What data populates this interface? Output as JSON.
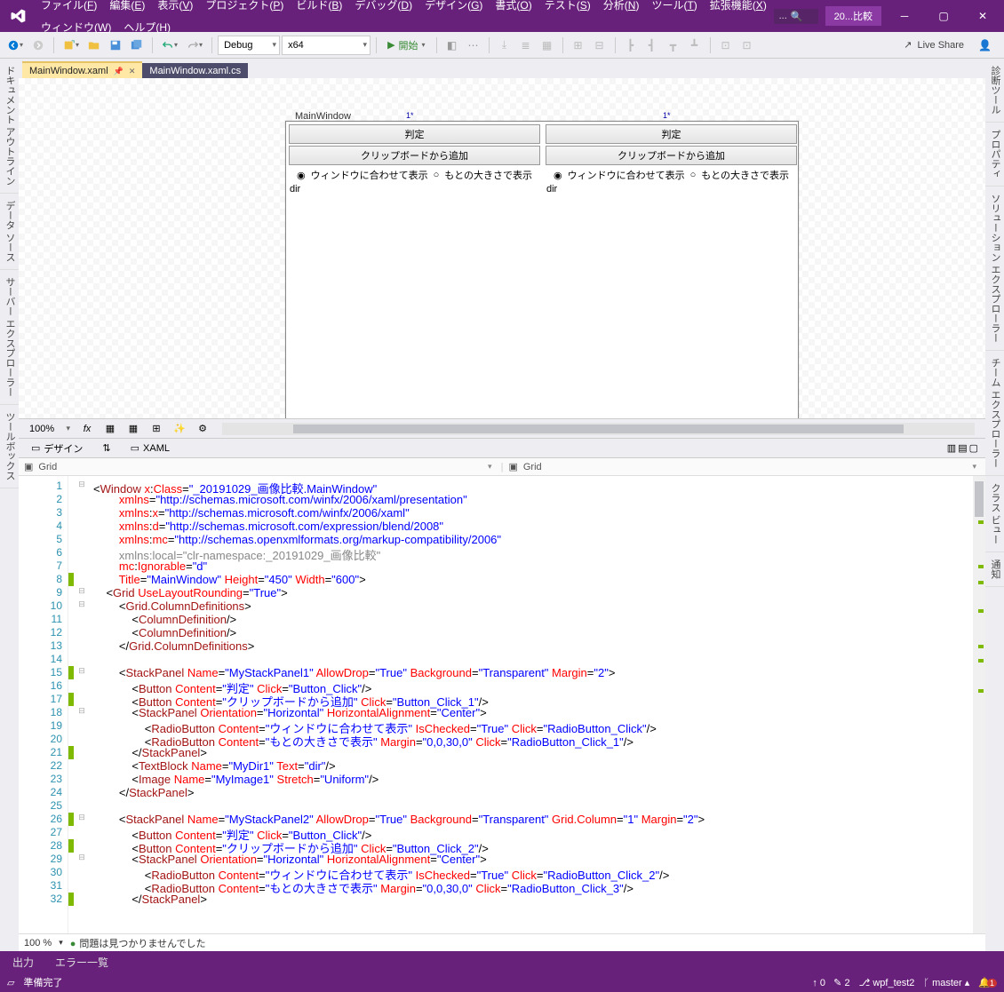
{
  "title_project": "20...比較",
  "search_placeholder": "...",
  "menus_row1": [
    "ファイル(F)",
    "編集(E)",
    "表示(V)",
    "プロジェクト(P)",
    "ビルド(B)",
    "デバッグ(D)",
    "デザイン(G)",
    "書式(O)",
    "テスト(S)",
    "分析(N)",
    "ツール(T)",
    "拡張機能(X)"
  ],
  "menus_row2": [
    "ウィンドウ(W)",
    "ヘルプ(H)"
  ],
  "toolbar": {
    "config": "Debug",
    "platform": "x64",
    "start": "開始",
    "liveshare": "Live Share"
  },
  "left_tabs": [
    "ドキュメント アウトライン",
    "データ ソース",
    "サーバー エクスプローラー",
    "ツールボックス"
  ],
  "right_tabs": [
    "診断ツール",
    "プロパティ",
    "ソリューション エクスプローラー",
    "チーム エクスプローラー",
    "クラス ビュー",
    "通知"
  ],
  "doc_tabs": [
    {
      "label": "MainWindow.xaml",
      "active": true
    },
    {
      "label": "MainWindow.xaml.cs",
      "active": false
    }
  ],
  "designer": {
    "window_title": "MainWindow",
    "col_star": "1*",
    "btn_judge": "判定",
    "btn_clip": "クリップボードから追加",
    "radio_fit": "ウィンドウに合わせて表示",
    "radio_orig": "もとの大きさで表示",
    "dir": "dir",
    "zoom": "100%"
  },
  "split": {
    "design_label": "デザイン",
    "swap": "⇅",
    "xaml_label": "XAML",
    "path_left": "Grid",
    "path_right": "Grid"
  },
  "code_lines": [
    {
      "n": 1,
      "fold": "⊟",
      "mark": "",
      "html": "&lt;<span class='t-brown'>Window</span> <span class='t-attr'>x</span>:<span class='t-attr'>Class</span>=<span class='t-val'>\"_20191029_画像比較.MainWindow\"</span>"
    },
    {
      "n": 2,
      "fold": "",
      "mark": "",
      "html": "        <span class='t-attr'>xmlns</span>=<span class='t-val'>\"http://schemas.microsoft.com/winfx/2006/xaml/presentation\"</span>"
    },
    {
      "n": 3,
      "fold": "",
      "mark": "",
      "html": "        <span class='t-attr'>xmlns</span>:<span class='t-attr'>x</span>=<span class='t-val'>\"http://schemas.microsoft.com/winfx/2006/xaml\"</span>"
    },
    {
      "n": 4,
      "fold": "",
      "mark": "",
      "html": "        <span class='t-attr'>xmlns</span>:<span class='t-attr'>d</span>=<span class='t-val'>\"http://schemas.microsoft.com/expression/blend/2008\"</span>"
    },
    {
      "n": 5,
      "fold": "",
      "mark": "",
      "html": "        <span class='t-attr'>xmlns</span>:<span class='t-attr'>mc</span>=<span class='t-val'>\"http://schemas.openxmlformats.org/markup-compatibility/2006\"</span>"
    },
    {
      "n": 6,
      "fold": "",
      "mark": "",
      "html": "        <span class='t-gray'>xmlns:local=\"clr-namespace:_20191029_画像比較\"</span>"
    },
    {
      "n": 7,
      "fold": "",
      "mark": "",
      "html": "        <span class='t-attr'>mc</span>:<span class='t-attr'>Ignorable</span>=<span class='t-val'>\"d\"</span>"
    },
    {
      "n": 8,
      "fold": "",
      "mark": "g",
      "html": "        <span class='t-attr'>Title</span>=<span class='t-val'>\"MainWindow\"</span> <span class='t-attr'>Height</span>=<span class='t-val'>\"450\"</span> <span class='t-attr'>Width</span>=<span class='t-val'>\"600\"</span>&gt;"
    },
    {
      "n": 9,
      "fold": "⊟",
      "mark": "",
      "html": "    &lt;<span class='t-brown'>Grid</span> <span class='t-attr'>UseLayoutRounding</span>=<span class='t-val'>\"True\"</span>&gt;"
    },
    {
      "n": 10,
      "fold": "⊟",
      "mark": "",
      "html": "        &lt;<span class='t-brown'>Grid.ColumnDefinitions</span>&gt;"
    },
    {
      "n": 11,
      "fold": "",
      "mark": "",
      "html": "            &lt;<span class='t-brown'>ColumnDefinition</span>/&gt;"
    },
    {
      "n": 12,
      "fold": "",
      "mark": "",
      "html": "            &lt;<span class='t-brown'>ColumnDefinition</span>/&gt;"
    },
    {
      "n": 13,
      "fold": "",
      "mark": "",
      "html": "        &lt;/<span class='t-brown'>Grid.ColumnDefinitions</span>&gt;"
    },
    {
      "n": 14,
      "fold": "",
      "mark": "",
      "html": ""
    },
    {
      "n": 15,
      "fold": "⊟",
      "mark": "g",
      "html": "        &lt;<span class='t-brown'>StackPanel</span> <span class='t-attr'>Name</span>=<span class='t-val'>\"MyStackPanel1\"</span> <span class='t-attr'>AllowDrop</span>=<span class='t-val'>\"True\"</span> <span class='t-attr'>Background</span>=<span class='t-val'>\"Transparent\"</span> <span class='t-attr'>Margin</span>=<span class='t-val'>\"2\"</span>&gt;"
    },
    {
      "n": 16,
      "fold": "",
      "mark": "",
      "html": "            &lt;<span class='t-brown'>Button</span> <span class='t-attr'>Content</span>=<span class='t-val'>\"判定\"</span> <span class='t-attr'>Click</span>=<span class='t-val'>\"Button_Click\"</span>/&gt;"
    },
    {
      "n": 17,
      "fold": "",
      "mark": "g",
      "html": "            &lt;<span class='t-brown'>Button</span> <span class='t-attr'>Content</span>=<span class='t-val'>\"クリップボードから追加\"</span> <span class='t-attr'>Click</span>=<span class='t-val'>\"Button_Click_1\"</span>/&gt;"
    },
    {
      "n": 18,
      "fold": "⊟",
      "mark": "",
      "html": "            &lt;<span class='t-brown'>StackPanel</span> <span class='t-attr'>Orientation</span>=<span class='t-val'>\"Horizontal\"</span> <span class='t-attr'>HorizontalAlignment</span>=<span class='t-val'>\"Center\"</span>&gt;"
    },
    {
      "n": 19,
      "fold": "",
      "mark": "",
      "html": "                &lt;<span class='t-brown'>RadioButton</span> <span class='t-attr'>Content</span>=<span class='t-val'>\"ウィンドウに合わせて表示\"</span> <span class='t-attr'>IsChecked</span>=<span class='t-val'>\"True\"</span> <span class='t-attr'>Click</span>=<span class='t-val'>\"RadioButton_Click\"</span>/&gt;"
    },
    {
      "n": 20,
      "fold": "",
      "mark": "",
      "html": "                &lt;<span class='t-brown'>RadioButton</span> <span class='t-attr'>Content</span>=<span class='t-val'>\"もとの大きさで表示\"</span> <span class='t-attr'>Margin</span>=<span class='t-val'>\"0,0,30,0\"</span> <span class='t-attr'>Click</span>=<span class='t-val'>\"RadioButton_Click_1\"</span>/&gt;"
    },
    {
      "n": 21,
      "fold": "",
      "mark": "g",
      "html": "            &lt;/<span class='t-brown'>StackPanel</span>&gt;"
    },
    {
      "n": 22,
      "fold": "",
      "mark": "",
      "html": "            &lt;<span class='t-brown'>TextBlock</span> <span class='t-attr'>Name</span>=<span class='t-val'>\"MyDir1\"</span> <span class='t-attr'>Text</span>=<span class='t-val'>\"dir\"</span>/&gt;"
    },
    {
      "n": 23,
      "fold": "",
      "mark": "",
      "html": "            &lt;<span class='t-brown'>Image</span> <span class='t-attr'>Name</span>=<span class='t-val'>\"MyImage1\"</span> <span class='t-attr'>Stretch</span>=<span class='t-val'>\"Uniform\"</span>/&gt;"
    },
    {
      "n": 24,
      "fold": "",
      "mark": "",
      "html": "        &lt;/<span class='t-brown'>StackPanel</span>&gt;"
    },
    {
      "n": 25,
      "fold": "",
      "mark": "",
      "html": ""
    },
    {
      "n": 26,
      "fold": "⊟",
      "mark": "g",
      "html": "        &lt;<span class='t-brown'>StackPanel</span> <span class='t-attr'>Name</span>=<span class='t-val'>\"MyStackPanel2\"</span> <span class='t-attr'>AllowDrop</span>=<span class='t-val'>\"True\"</span> <span class='t-attr'>Background</span>=<span class='t-val'>\"Transparent\"</span> <span class='t-attr'>Grid.Column</span>=<span class='t-val'>\"1\"</span> <span class='t-attr'>Margin</span>=<span class='t-val'>\"2\"</span>&gt;"
    },
    {
      "n": 27,
      "fold": "",
      "mark": "",
      "html": "            &lt;<span class='t-brown'>Button</span> <span class='t-attr'>Content</span>=<span class='t-val'>\"判定\"</span> <span class='t-attr'>Click</span>=<span class='t-val'>\"Button_Click\"</span>/&gt;"
    },
    {
      "n": 28,
      "fold": "",
      "mark": "g",
      "html": "            &lt;<span class='t-brown'>Button</span> <span class='t-attr'>Content</span>=<span class='t-val'>\"クリップボードから追加\"</span> <span class='t-attr'>Click</span>=<span class='t-val'>\"Button_Click_2\"</span>/&gt;"
    },
    {
      "n": 29,
      "fold": "⊟",
      "mark": "",
      "html": "            &lt;<span class='t-brown'>StackPanel</span> <span class='t-attr'>Orientation</span>=<span class='t-val'>\"Horizontal\"</span> <span class='t-attr'>HorizontalAlignment</span>=<span class='t-val'>\"Center\"</span>&gt;"
    },
    {
      "n": 30,
      "fold": "",
      "mark": "",
      "html": "                &lt;<span class='t-brown'>RadioButton</span> <span class='t-attr'>Content</span>=<span class='t-val'>\"ウィンドウに合わせて表示\"</span> <span class='t-attr'>IsChecked</span>=<span class='t-val'>\"True\"</span> <span class='t-attr'>Click</span>=<span class='t-val'>\"RadioButton_Click_2\"</span>/&gt;"
    },
    {
      "n": 31,
      "fold": "",
      "mark": "",
      "html": "                &lt;<span class='t-brown'>RadioButton</span> <span class='t-attr'>Content</span>=<span class='t-val'>\"もとの大きさで表示\"</span> <span class='t-attr'>Margin</span>=<span class='t-val'>\"0,0,30,0\"</span> <span class='t-attr'>Click</span>=<span class='t-val'>\"RadioButton_Click_3\"</span>/&gt;"
    },
    {
      "n": 32,
      "fold": "",
      "mark": "g",
      "html": "            &lt;/<span class='t-brown'>StackPanel</span>&gt;"
    }
  ],
  "editor_status": {
    "zoom": "100 %",
    "msg": "問題は見つかりませんでした"
  },
  "bottom_tabs": [
    "出力",
    "エラー一覧"
  ],
  "statusbar": {
    "ready": "準備完了",
    "changes": "2",
    "repo": "wpf_test2",
    "branch": "master",
    "notif": "1"
  }
}
